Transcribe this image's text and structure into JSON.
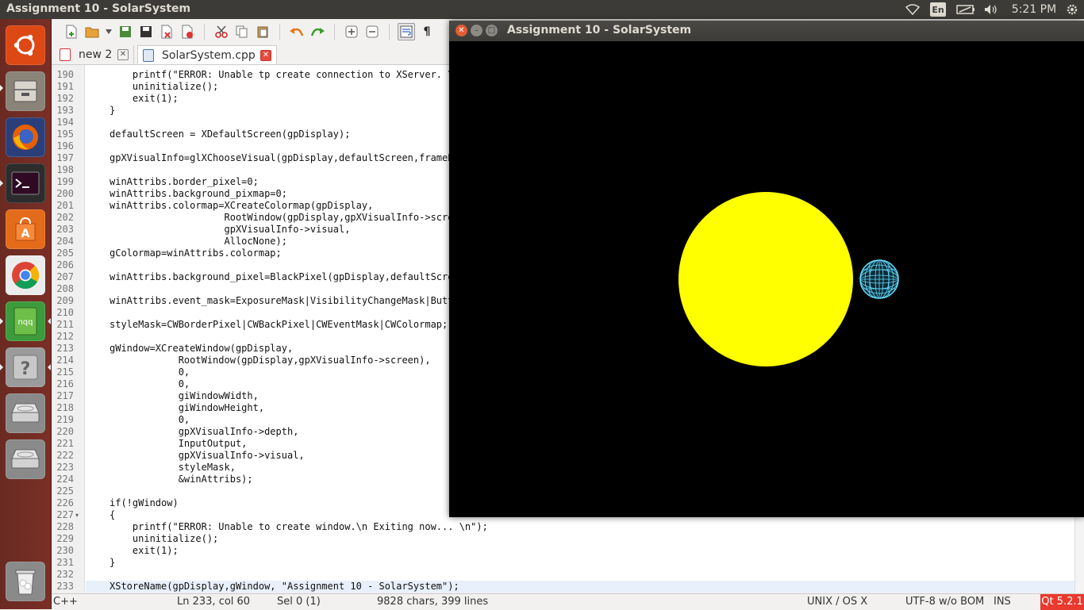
{
  "top_panel": {
    "title": "Assignment 10 - SolarSystem",
    "language": "En",
    "time": "5:21 PM",
    "icons": [
      "wifi-icon",
      "battery-icon",
      "volume-icon",
      "gear-icon"
    ]
  },
  "launcher": {
    "items": [
      "ubuntu-dash",
      "files",
      "firefox",
      "terminal",
      "software-center",
      "chrome",
      "notepadqq",
      "help",
      "disk-drive-1",
      "disk-drive-2",
      "trash"
    ],
    "notepadqq_label": "nqq"
  },
  "editor": {
    "tabs": [
      {
        "label": "new 2"
      },
      {
        "label": "SolarSystem.cpp"
      }
    ],
    "lines": [
      {
        "n": "190",
        "text": "    printf(\"ERROR: Unable tp create connection to XServer. \\"
      },
      {
        "n": "191",
        "text": "    uninitialize();"
      },
      {
        "n": "192",
        "text": "    exit(1);"
      },
      {
        "n": "193",
        "text": "}"
      },
      {
        "n": "194",
        "text": ""
      },
      {
        "n": "195",
        "text": "defaultScreen = XDefaultScreen(gpDisplay);"
      },
      {
        "n": "196",
        "text": ""
      },
      {
        "n": "197",
        "text": "gpXVisualInfo=glXChooseVisual(gpDisplay,defaultScreen,frameB"
      },
      {
        "n": "198",
        "text": ""
      },
      {
        "n": "199",
        "text": "winAttribs.border_pixel=0;"
      },
      {
        "n": "200",
        "text": "winAttribs.background_pixmap=0;"
      },
      {
        "n": "201",
        "text": "winAttribs.colormap=XCreateColormap(gpDisplay,"
      },
      {
        "n": "202",
        "text": "                    RootWindow(gpDisplay,gpXVisualInfo->scre"
      },
      {
        "n": "203",
        "text": "                    gpXVisualInfo->visual,"
      },
      {
        "n": "204",
        "text": "                    AllocNone);"
      },
      {
        "n": "205",
        "text": "gColormap=winAttribs.colormap;"
      },
      {
        "n": "206",
        "text": ""
      },
      {
        "n": "207",
        "text": "winAttribs.background_pixel=BlackPixel(gpDisplay,defaultScre"
      },
      {
        "n": "208",
        "text": ""
      },
      {
        "n": "209",
        "text": "winAttribs.event_mask=ExposureMask|VisibilityChangeMask|Butt"
      },
      {
        "n": "210",
        "text": ""
      },
      {
        "n": "211",
        "text": "styleMask=CWBorderPixel|CWBackPixel|CWEventMask|CWColormap;"
      },
      {
        "n": "212",
        "text": ""
      },
      {
        "n": "213",
        "text": "gWindow=XCreateWindow(gpDisplay,"
      },
      {
        "n": "214",
        "text": "            RootWindow(gpDisplay,gpXVisualInfo->screen),"
      },
      {
        "n": "215",
        "text": "            0,"
      },
      {
        "n": "216",
        "text": "            0,"
      },
      {
        "n": "217",
        "text": "            giWindowWidth,"
      },
      {
        "n": "218",
        "text": "            giWindowHeight,"
      },
      {
        "n": "219",
        "text": "            0,"
      },
      {
        "n": "220",
        "text": "            gpXVisualInfo->depth,"
      },
      {
        "n": "221",
        "text": "            InputOutput,"
      },
      {
        "n": "222",
        "text": "            gpXVisualInfo->visual,"
      },
      {
        "n": "223",
        "text": "            styleMask,"
      },
      {
        "n": "224",
        "text": "            &winAttribs);"
      },
      {
        "n": "225",
        "text": ""
      },
      {
        "n": "226",
        "text": "if(!gWindow)"
      },
      {
        "n": "227",
        "text": "{"
      },
      {
        "n": "228",
        "text": "    printf(\"ERROR: Unable to create window.\\n Exiting now... \\n\");"
      },
      {
        "n": "229",
        "text": "    uninitialize();"
      },
      {
        "n": "230",
        "text": "    exit(1);"
      },
      {
        "n": "231",
        "text": "}"
      },
      {
        "n": "232",
        "text": ""
      },
      {
        "n": "233",
        "text": "XStoreName(gpDisplay,gWindow, \"Assignment 10 - SolarSystem\");"
      }
    ]
  },
  "statusbar": {
    "language": "C++",
    "position": "Ln 233, col 60",
    "selection": "Sel 0 (1)",
    "counts": "9828 chars, 399 lines",
    "eol": "UNIX / OS X",
    "encoding": "UTF-8 w/o BOM",
    "mode": "INS",
    "qt": "Qt 5.2.1"
  },
  "gl_window": {
    "title": "Assignment 10 - SolarSystem",
    "sun_color": "#ffff00",
    "earth_color": "#66ddff",
    "background": "#000000"
  }
}
